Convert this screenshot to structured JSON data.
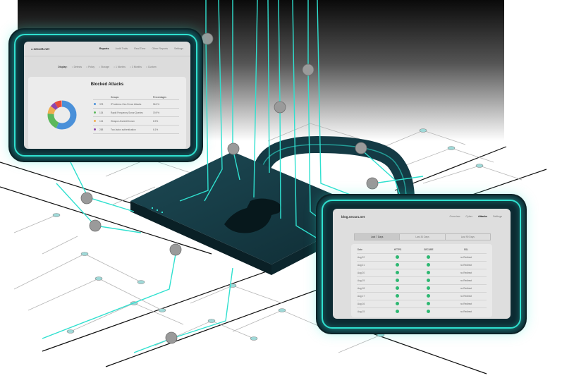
{
  "left_screen": {
    "logo": "secur1.net",
    "nav": [
      "Reports",
      "Audit Trails",
      "Real Time",
      "Other Reports",
      "Settings"
    ],
    "filter_label": "Display:",
    "filters": [
      "Detects",
      "Policy",
      "Storage",
      "1 Months",
      "3 Months",
      "Custom"
    ],
    "card_title": "Blocked Attacks",
    "table_headers": [
      "Groups",
      "Percentages"
    ],
    "rows": [
      {
        "value": "378",
        "label": "IP Address Geo-Fence Attacks",
        "pct": "56.3%"
      },
      {
        "value": "134",
        "label": "Rapid Frequency Sonar Queries",
        "pct": "19.9%"
      },
      {
        "value": "104",
        "label": "Weapon Ancient/Known",
        "pct": "8.9%"
      },
      {
        "value": "288",
        "label": "Two-factor authentication",
        "pct": "6.1%"
      }
    ],
    "colors": [
      "#4a90d9",
      "#5cb85c",
      "#f0ad4e",
      "#8e44ad"
    ]
  },
  "right_screen": {
    "logo": "blog.secur1.net",
    "nav": [
      "Overview",
      "Cyber",
      "Attacks",
      "Settings"
    ],
    "tabs": [
      "Last 7 Days",
      "Last 30 Days",
      "Last 90 Days"
    ],
    "columns": [
      "Date",
      "HTTPS",
      "SECURE",
      "SSL"
    ],
    "rows": [
      {
        "date": "Aug 22",
        "ssl": "no Redirect"
      },
      {
        "date": "Aug 21",
        "ssl": "no Redirect"
      },
      {
        "date": "Aug 20",
        "ssl": "no Redirect"
      },
      {
        "date": "Aug 19",
        "ssl": "no Redirect"
      },
      {
        "date": "Aug 18",
        "ssl": "no Redirect"
      },
      {
        "date": "Aug 17",
        "ssl": "no Redirect"
      },
      {
        "date": "Aug 16",
        "ssl": "no Redirect"
      },
      {
        "date": "Aug 15",
        "ssl": "no Redirect"
      }
    ]
  },
  "colors": {
    "glow": "#2fe0cf",
    "lock": "#143a44",
    "circuit": "#a9a9a9"
  }
}
